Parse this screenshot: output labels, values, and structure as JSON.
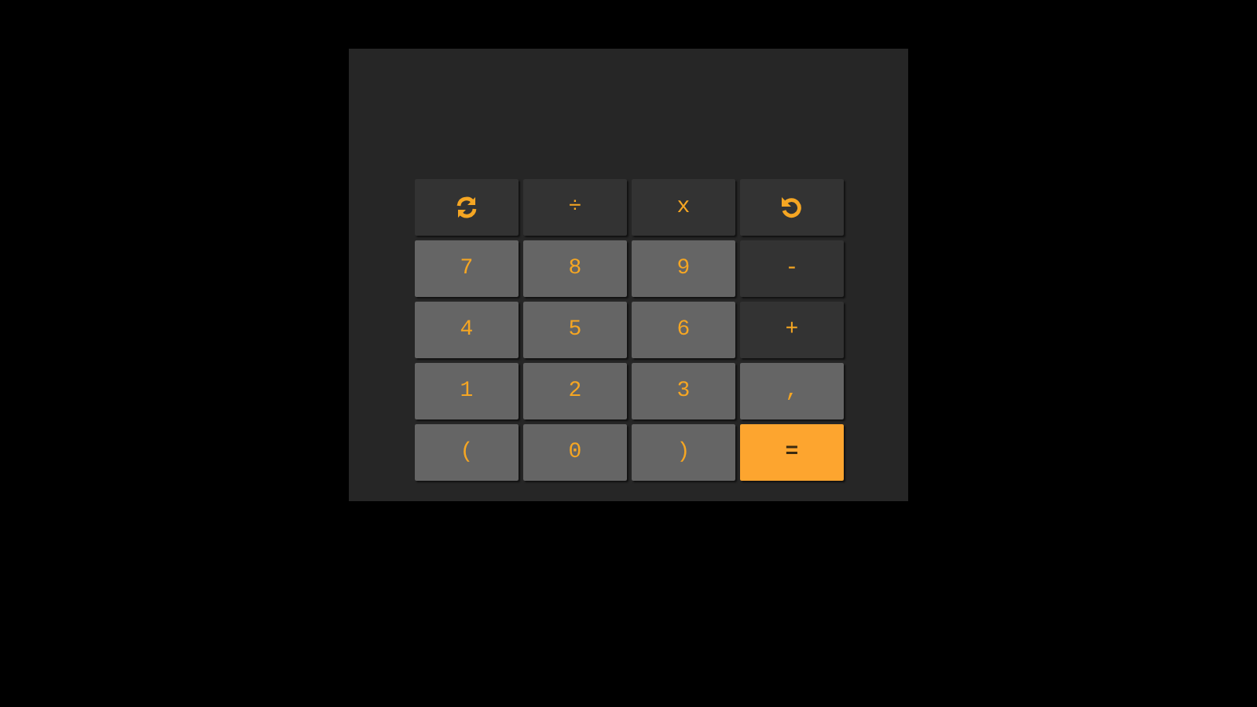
{
  "keys": [
    {
      "kind": "refresh"
    },
    {
      "kind": "operator",
      "label": "÷"
    },
    {
      "kind": "operator",
      "label": "x"
    },
    {
      "kind": "undo"
    },
    {
      "kind": "digit",
      "label": "7"
    },
    {
      "kind": "digit",
      "label": "8"
    },
    {
      "kind": "digit",
      "label": "9"
    },
    {
      "kind": "operator",
      "label": "-"
    },
    {
      "kind": "digit",
      "label": "4"
    },
    {
      "kind": "digit",
      "label": "5"
    },
    {
      "kind": "digit",
      "label": "6"
    },
    {
      "kind": "operator",
      "label": "+"
    },
    {
      "kind": "digit",
      "label": "1"
    },
    {
      "kind": "digit",
      "label": "2"
    },
    {
      "kind": "digit",
      "label": "3"
    },
    {
      "kind": "digit",
      "label": ","
    },
    {
      "kind": "digit",
      "label": "("
    },
    {
      "kind": "digit",
      "label": "0"
    },
    {
      "kind": "digit",
      "label": ")"
    },
    {
      "kind": "equals",
      "label": "="
    }
  ]
}
